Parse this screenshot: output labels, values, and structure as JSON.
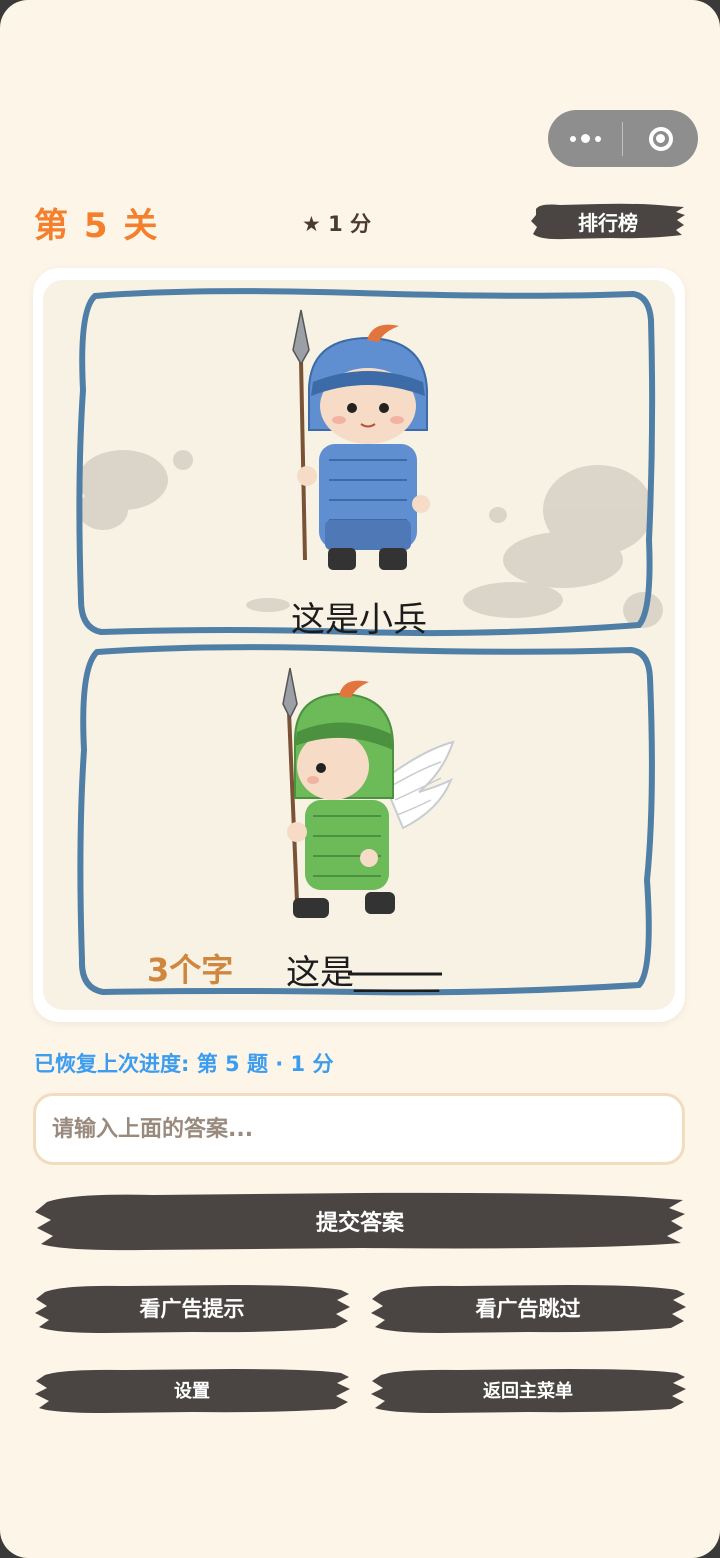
{
  "header": {
    "level": "第 5 关",
    "score": "★ 1 分",
    "leaderboard_label": "排行榜"
  },
  "puzzle": {
    "caption_top": "这是小兵",
    "hint": "3个字",
    "caption_bottom": "这是_____"
  },
  "status": {
    "restore_text": "已恢复上次进度: 第 5 题 · 1 分"
  },
  "answer": {
    "placeholder": "请输入上面的答案...",
    "value": ""
  },
  "buttons": {
    "submit": "提交答案",
    "ad_hint": "看广告提示",
    "ad_skip": "看广告跳过",
    "settings": "设置",
    "main_menu": "返回主菜单"
  },
  "colors": {
    "background": "#fdf5e8",
    "accent_orange": "#f47f2c",
    "brush_dark": "#4a4543",
    "info_blue": "#3b9cf0",
    "frame_blue": "#4f7ea6"
  },
  "icons": [
    "more-icon",
    "close-miniprogram-icon",
    "star-icon"
  ]
}
